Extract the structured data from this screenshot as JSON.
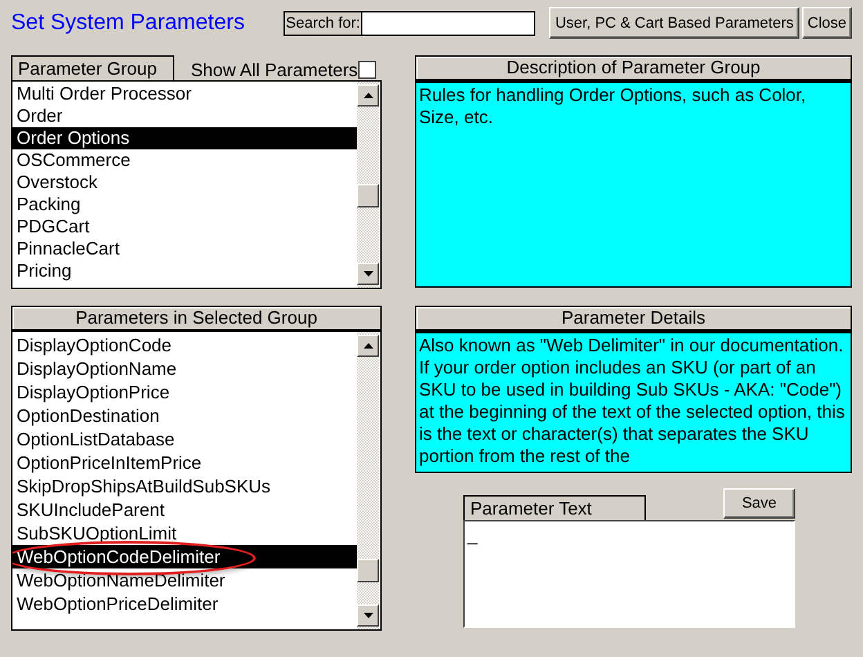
{
  "window": {
    "title": "Set System Parameters"
  },
  "search": {
    "label": "Search for:"
  },
  "buttons": [
    {
      "label": "User, PC & Cart Based Parameters"
    },
    {
      "label": "Close"
    }
  ],
  "parameter_group": {
    "title": "Parameter Group",
    "show_all": {
      "label": "Show All Parameters",
      "checked": false
    },
    "items": [
      {
        "label": "Multi Order Processor",
        "selected": false
      },
      {
        "label": "Order",
        "selected": false
      },
      {
        "label": "Order Options",
        "selected": true
      },
      {
        "label": "OSCommerce",
        "selected": false
      },
      {
        "label": "Overstock",
        "selected": false
      },
      {
        "label": "Packing",
        "selected": false
      },
      {
        "label": "PDGCart",
        "selected": false
      },
      {
        "label": "PinnacleCart",
        "selected": false
      },
      {
        "label": "Pricing",
        "selected": false
      }
    ]
  },
  "description": {
    "title": "Description of Parameter Group",
    "text": "Rules for handling Order Options, such as Color, Size, etc."
  },
  "parameters": {
    "title": "Parameters in Selected Group",
    "items": [
      {
        "label": "DisplayOptionCode",
        "selected": false,
        "circled": false
      },
      {
        "label": "DisplayOptionName",
        "selected": false,
        "circled": false
      },
      {
        "label": "DisplayOptionPrice",
        "selected": false,
        "circled": false
      },
      {
        "label": "OptionDestination",
        "selected": false,
        "circled": false
      },
      {
        "label": "OptionListDatabase",
        "selected": false,
        "circled": false
      },
      {
        "label": "OptionPriceInItemPrice",
        "selected": false,
        "circled": false
      },
      {
        "label": "SkipDropShipsAtBuildSubSKUs",
        "selected": false,
        "circled": false
      },
      {
        "label": "SKUIncludeParent",
        "selected": false,
        "circled": false
      },
      {
        "label": "SubSKUOptionLimit",
        "selected": false,
        "circled": false
      },
      {
        "label": "WebOptionCodeDelimiter",
        "selected": true,
        "circled": true
      },
      {
        "label": "WebOptionNameDelimiter",
        "selected": false,
        "circled": false
      },
      {
        "label": "WebOptionPriceDelimiter",
        "selected": false,
        "circled": false
      }
    ]
  },
  "details": {
    "title": "Parameter Details",
    "text": "Also known as \"Web Delimiter\" in our documentation. If your order option includes an SKU (or part of an SKU to be used in building Sub SKUs - AKA: \"Code\") at the beginning of the text of the selected option, this is the text or character(s) that separates the SKU portion from the rest of the"
  },
  "parameter_text": {
    "label": "Parameter Text",
    "value": "_",
    "save_label": "Save"
  }
}
